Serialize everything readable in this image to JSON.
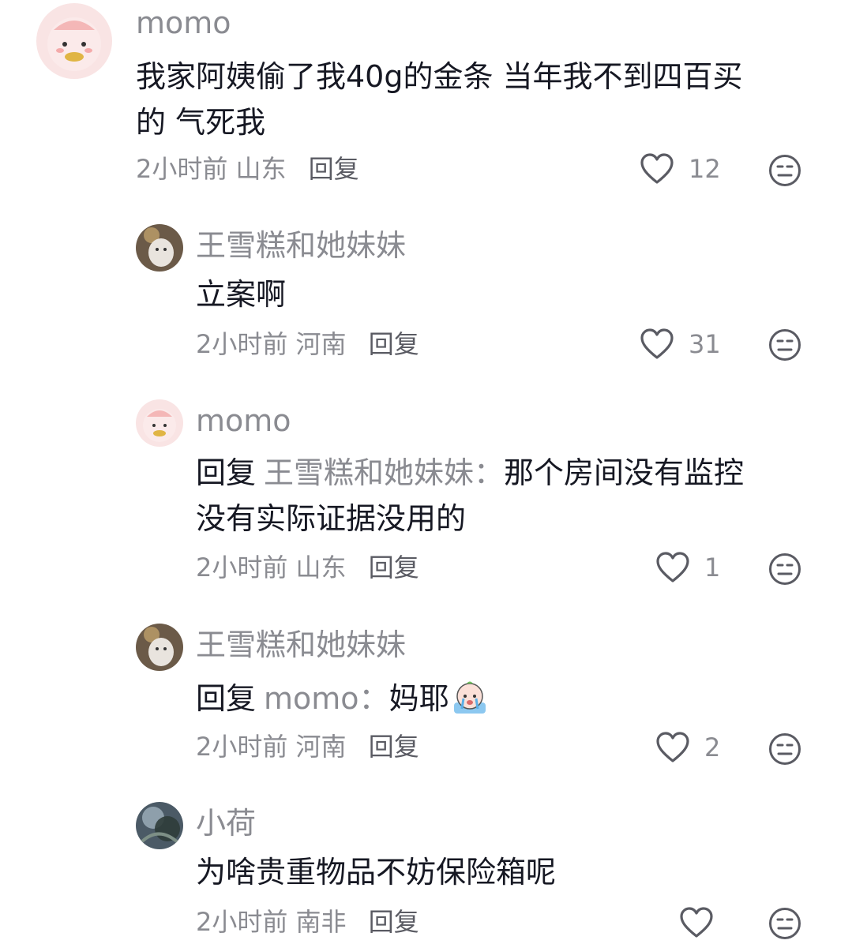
{
  "comments": [
    {
      "author": "momo",
      "text": "我家阿姨偷了我40g的金条 当年我不到四百买的 气死我",
      "text_line1": "我家阿姨偷了我40g的金条 当年我不到四百买",
      "text_line2": "的 气死我",
      "time": "2小时前",
      "location": "山东",
      "reply_label": "回复",
      "likes": "12"
    },
    {
      "author": "王雪糕和她妹妹",
      "text": "立案啊",
      "time": "2小时前",
      "location": "河南",
      "reply_label": "回复",
      "likes": "31"
    },
    {
      "author": "momo",
      "reply_prefix": "回复",
      "reply_to": "王雪糕和她妹妹：",
      "text": "那个房间没有监控没有实际证据没用的",
      "text_line1": "那个房间没有监控",
      "text_line2": "没有实际证据没用的",
      "time": "2小时前",
      "location": "山东",
      "reply_label": "回复",
      "likes": "1"
    },
    {
      "author": "王雪糕和她妹妹",
      "reply_prefix": "回复",
      "reply_to": "momo：",
      "text": "妈耶",
      "time": "2小时前",
      "location": "河南",
      "reply_label": "回复",
      "likes": "2"
    },
    {
      "author": "小荷",
      "text": "为啥贵重物品不妨保险箱呢",
      "time": "2小时前",
      "location": "南非",
      "reply_label": "回复",
      "likes": ""
    }
  ],
  "icons": {
    "like": "heart-outline-icon",
    "dislike": "meh-face-icon",
    "sticker": "crying-peach-sticker"
  },
  "colors": {
    "text": "#161823",
    "secondary": "#8a8b91",
    "avatar_pink": "#f7dede"
  }
}
